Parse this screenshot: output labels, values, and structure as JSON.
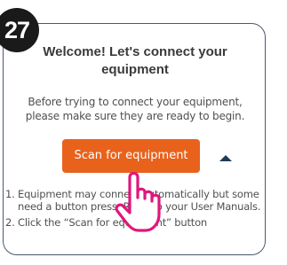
{
  "step_badge": "27",
  "dialog": {
    "title": "Welcome! Let's connect your equipment",
    "intro": "Before trying to connect your equipment, please make sure they are ready to begin.",
    "scan_button_label": "Scan for equipment",
    "collapse_icon": "chevron-up-icon",
    "steps": [
      {
        "number": "1.",
        "text": "Equipment may connect automatically but some need a button press. Refer to your User Manuals."
      },
      {
        "number": "2.",
        "text": "Click the “Scan for equipment” button"
      }
    ]
  },
  "colors": {
    "accent": "#e8621c",
    "cursor": "#e0177a",
    "border": "#4b5a6b",
    "badge": "#1a1a1a",
    "chevron": "#1f3a5a"
  },
  "cursor_icon": "hand-pointer-icon"
}
